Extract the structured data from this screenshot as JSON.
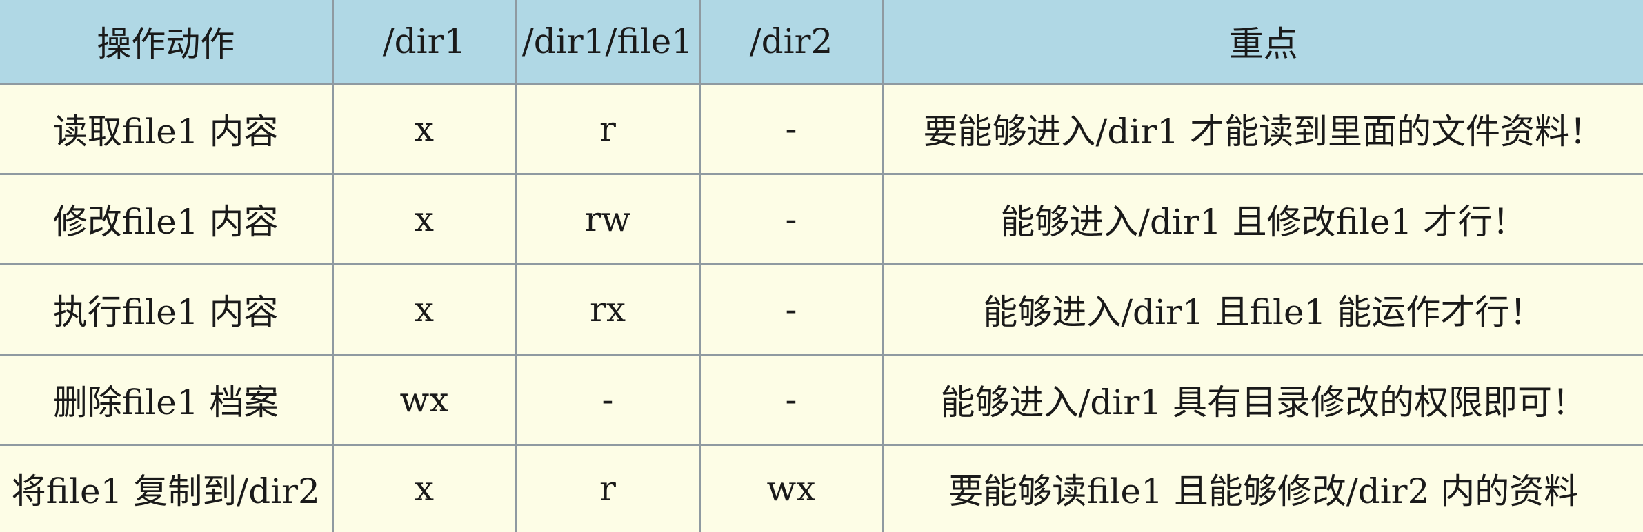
{
  "table": {
    "headers": [
      "操作动作",
      "/dir1",
      "/dir1/file1",
      "/dir2",
      "重点"
    ],
    "rows": [
      [
        "读取file1 内容",
        "x",
        "r",
        "-",
        "要能够进入/dir1 才能读到里面的文件资料！"
      ],
      [
        "修改file1 内容",
        "x",
        "rw",
        "-",
        "能够进入/dir1 且修改file1 才行！"
      ],
      [
        "执行file1 内容",
        "x",
        "rx",
        "-",
        "能够进入/dir1 且file1 能运作才行！"
      ],
      [
        "删除file1 档案",
        "wx",
        "-",
        "-",
        "能够进入/dir1 具有目录修改的权限即可！"
      ],
      [
        "将file1 复制到/dir2",
        "x",
        "r",
        "wx",
        "要能够读file1 且能够修改/dir2 内的资料"
      ]
    ]
  },
  "colors": {
    "header_bg": "#b0d8e5",
    "body_bg": "#fdfde6",
    "border": "#8f9aa1"
  }
}
